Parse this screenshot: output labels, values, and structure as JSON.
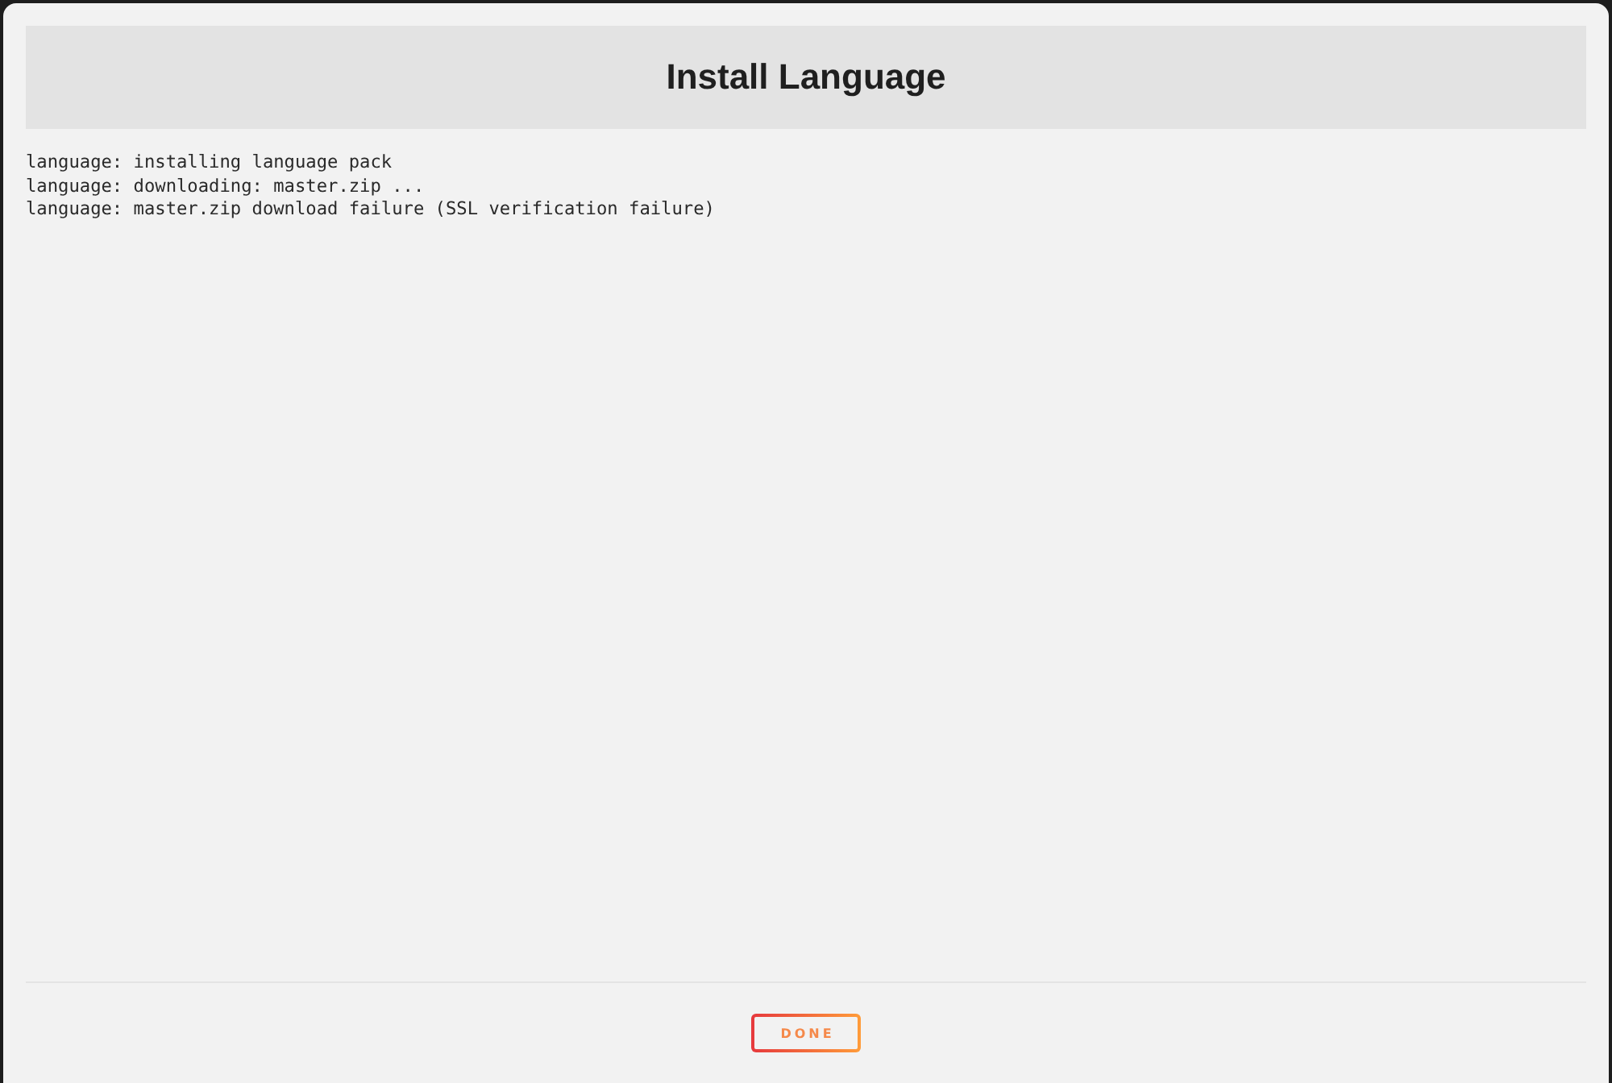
{
  "dialog": {
    "title": "Install Language",
    "log_lines": [
      "language: installing language pack",
      "language: downloading: master.zip ...",
      "language: master.zip download failure (SSL verification failure)"
    ],
    "buttons": [
      "DONE"
    ]
  }
}
